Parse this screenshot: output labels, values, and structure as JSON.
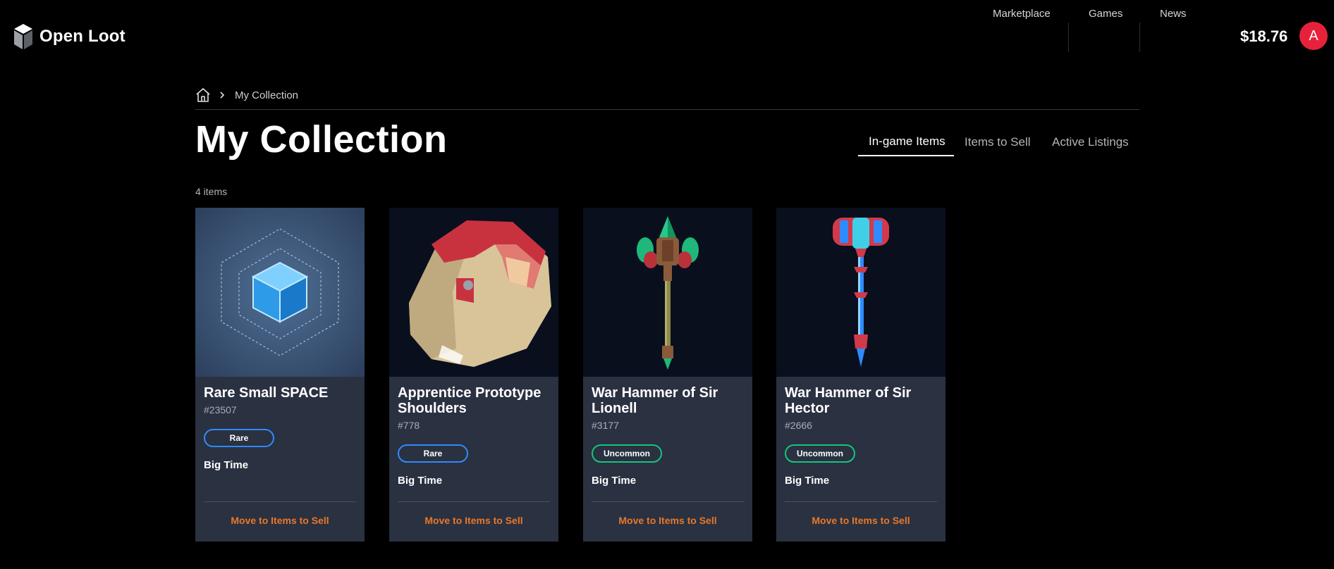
{
  "app": {
    "name": "Open Loot"
  },
  "nav": {
    "items": [
      {
        "label": "Marketplace"
      },
      {
        "label": "Games"
      },
      {
        "label": "News"
      }
    ]
  },
  "account": {
    "balance": "$18.76",
    "avatar_letter": "A",
    "avatar_color": "#e8213a"
  },
  "breadcrumb": {
    "current": "My Collection"
  },
  "page": {
    "title": "My Collection",
    "item_count": "4 items"
  },
  "tabs": [
    {
      "label": "In-game Items",
      "active": true
    },
    {
      "label": "Items to Sell",
      "active": false
    },
    {
      "label": "Active Listings",
      "active": false
    }
  ],
  "colors": {
    "card_bg": "#2a3141",
    "action": "#e8782a",
    "rare": "#2f8bff",
    "uncommon": "#16c47a"
  },
  "items": [
    {
      "name": "Rare Small SPACE",
      "id": "#23507",
      "rarity": "Rare",
      "game": "Big Time",
      "action": "Move to Items to Sell",
      "icon": "space-cube-icon"
    },
    {
      "name": "Apprentice Prototype Shoulders",
      "id": "#778",
      "rarity": "Rare",
      "game": "Big Time",
      "action": "Move to Items to Sell",
      "icon": "shoulder-armor-icon"
    },
    {
      "name": "War Hammer of Sir Lionell",
      "id": "#3177",
      "rarity": "Uncommon",
      "game": "Big Time",
      "action": "Move to Items to Sell",
      "icon": "war-hammer-icon"
    },
    {
      "name": "War Hammer of Sir Hector",
      "id": "#2666",
      "rarity": "Uncommon",
      "game": "Big Time",
      "action": "Move to Items to Sell",
      "icon": "war-hammer-icon"
    }
  ]
}
